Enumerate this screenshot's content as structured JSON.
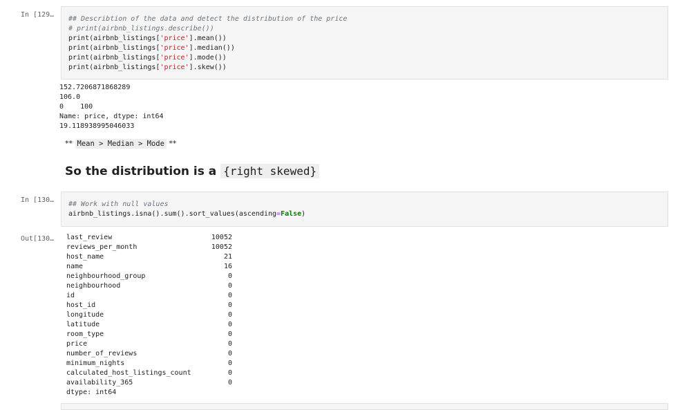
{
  "cells": {
    "cell1": {
      "prompt": "In [129…",
      "code": {
        "comment1": "## Describtion of the data and detect the distribution of the price",
        "comment2": "# print(airbnb_listings.describe())",
        "lines": [
          {
            "pre": "print(airbnb_listings[",
            "str": "'price'",
            "post": "].mean())"
          },
          {
            "pre": "print(airbnb_listings[",
            "str": "'price'",
            "post": "].median())"
          },
          {
            "pre": "print(airbnb_listings[",
            "str": "'price'",
            "post": "].mode())"
          },
          {
            "pre": "print(airbnb_listings[",
            "str": "'price'",
            "post": "].skew())"
          }
        ]
      },
      "output": [
        "152.7206871868289",
        "106.0",
        "0    100",
        "Name: price, dtype: int64",
        "19.118938995046033"
      ]
    },
    "markdown": {
      "small_prefix": "** ",
      "small_code": "Mean > Median > Mode",
      "small_suffix": " **",
      "heading_text": "So the distribution is a",
      "heading_code": "{right skewed}"
    },
    "cell2": {
      "prompt": "In [130…",
      "code": {
        "comment": "## Work with null values",
        "pre": "airbnb_listings.isna().sum().sort_values(ascending",
        "op": "=",
        "kw": "False",
        "post": ")"
      },
      "out_prompt": "Out[130…",
      "rows": [
        {
          "key": "last_review",
          "value": "10052"
        },
        {
          "key": "reviews_per_month",
          "value": "10052"
        },
        {
          "key": "host_name",
          "value": "21"
        },
        {
          "key": "name",
          "value": "16"
        },
        {
          "key": "neighbourhood_group",
          "value": "0"
        },
        {
          "key": "neighbourhood",
          "value": "0"
        },
        {
          "key": "id",
          "value": "0"
        },
        {
          "key": "host_id",
          "value": "0"
        },
        {
          "key": "longitude",
          "value": "0"
        },
        {
          "key": "latitude",
          "value": "0"
        },
        {
          "key": "room_type",
          "value": "0"
        },
        {
          "key": "price",
          "value": "0"
        },
        {
          "key": "number_of_reviews",
          "value": "0"
        },
        {
          "key": "minimum_nights",
          "value": "0"
        },
        {
          "key": "calculated_host_listings_count",
          "value": "0"
        },
        {
          "key": "availability_365",
          "value": "0"
        }
      ],
      "dtype": "dtype: int64"
    }
  }
}
